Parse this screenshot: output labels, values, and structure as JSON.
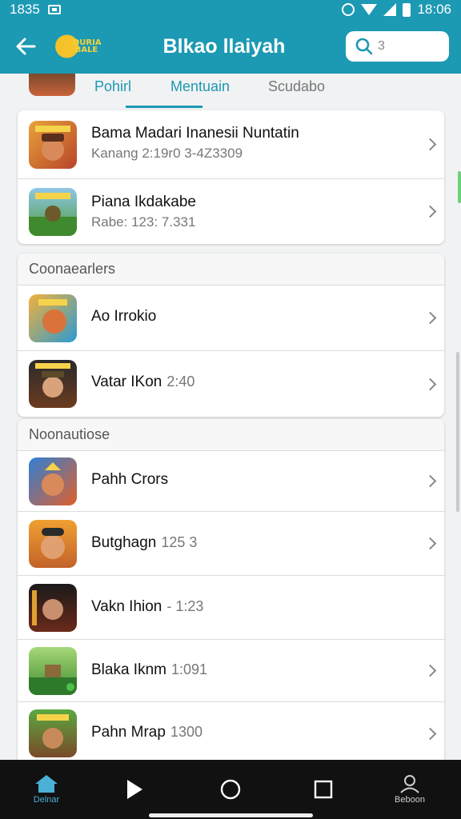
{
  "status_bar": {
    "time_left": "1835",
    "time_right": "18:06"
  },
  "app_bar": {
    "title": "Blkao llaiyah",
    "logo_text": "DURIA BALE",
    "search_value": "3"
  },
  "tabs": [
    {
      "label": "Pohirl"
    },
    {
      "label": "Mentuain"
    },
    {
      "label": "Scudabo"
    }
  ],
  "top_card": [
    {
      "title": "Bama Madari Inanesii Nuntatin",
      "subtitle": "Kanang 2:19r0 3-4Z3309"
    },
    {
      "title": "Piana Ikdakabe",
      "subtitle": "Rabe: 123: 7.331"
    }
  ],
  "section1": {
    "header": "Coonaearlers",
    "items": [
      {
        "title": "Ao Irrokio",
        "meta": ""
      },
      {
        "title": "Vatar IKon",
        "meta": "2:40"
      }
    ]
  },
  "section2": {
    "header": "Noonautiose",
    "items": [
      {
        "title": "Pahh Crors",
        "meta": ""
      },
      {
        "title": "Butghagn",
        "meta": "125 3"
      },
      {
        "title": "Vakn Ihion",
        "meta": "- 1:23"
      },
      {
        "title": "Blaka Iknm",
        "meta": "1:091"
      },
      {
        "title": "Pahn Mrap",
        "meta": "1300"
      }
    ]
  },
  "nav": {
    "home_label": "Delnar",
    "profile_label": "Beboon"
  },
  "colors": {
    "accent": "#1c99b3",
    "nav_bg": "#111111",
    "nav_active": "#4bb0d6"
  }
}
